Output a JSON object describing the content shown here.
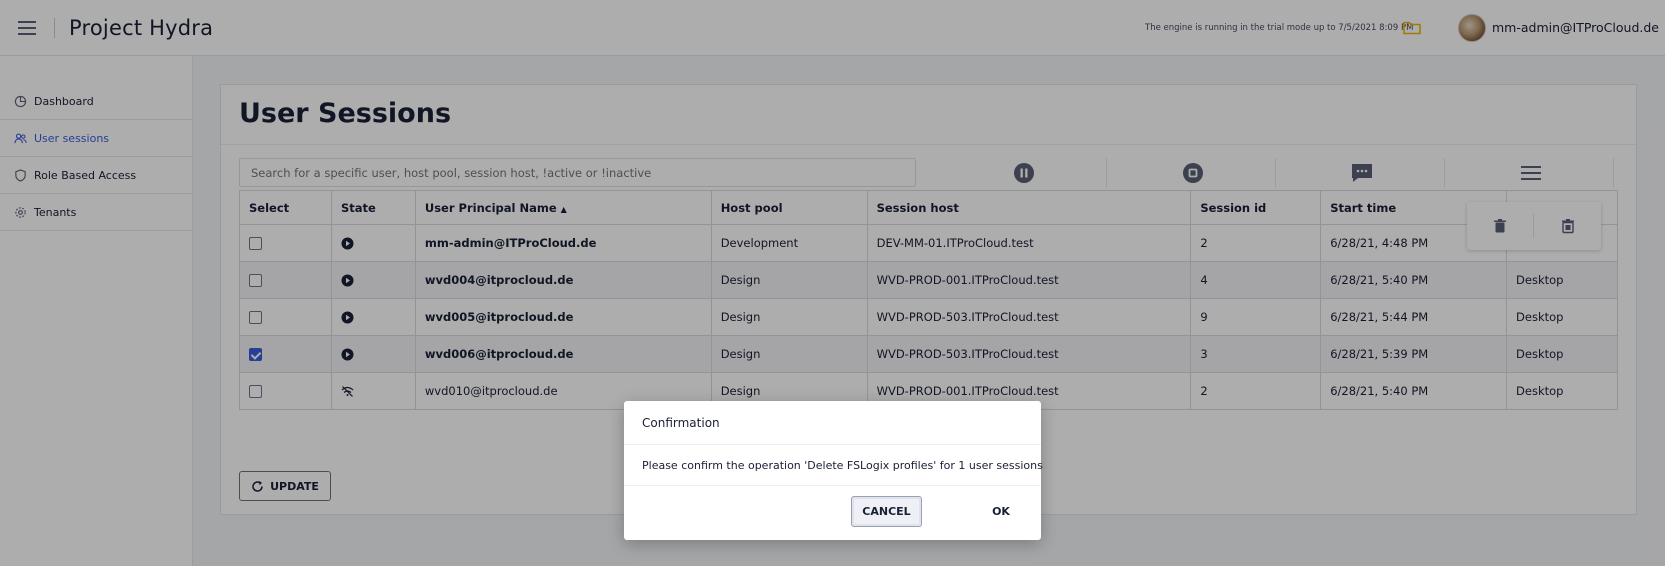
{
  "header": {
    "app_title": "Project Hydra",
    "trial_notice": "The engine is running in the trial mode up to 7/5/2021 8:09 PM",
    "user": "mm-admin@ITProCloud.de",
    "folder_color": "#f0b400"
  },
  "sidebar": {
    "items": [
      {
        "label": "Dashboard",
        "icon": "pie-chart-icon"
      },
      {
        "label": "User sessions",
        "icon": "users-icon",
        "active": true
      },
      {
        "label": "Role Based Access",
        "icon": "shield-icon"
      },
      {
        "label": "Tenants",
        "icon": "gear-icon"
      }
    ]
  },
  "main": {
    "title": "User Sessions",
    "search_placeholder": "Search for a specific user, host pool, session host, !active or !inactive",
    "toolbar_icons": [
      "pause-icon",
      "stop-icon",
      "message-icon",
      "menu-icon"
    ],
    "columns": [
      "Select",
      "State",
      "User Principal Name",
      "Host pool",
      "Session host",
      "Session id",
      "Start time",
      ""
    ],
    "sort_indicator": "▲",
    "rows": [
      {
        "checked": false,
        "state": "active",
        "upn": "mm-admin@ITProCloud.de",
        "host_pool": "Development",
        "session_host": "DEV-MM-01.ITProCloud.test",
        "session_id": "2",
        "start_time": "6/28/21, 4:48 PM",
        "type": ""
      },
      {
        "checked": false,
        "state": "active",
        "upn": "wvd004@itprocloud.de",
        "host_pool": "Design",
        "session_host": "WVD-PROD-001.ITProCloud.test",
        "session_id": "4",
        "start_time": "6/28/21, 5:40 PM",
        "type": "Desktop"
      },
      {
        "checked": false,
        "state": "active",
        "upn": "wvd005@itprocloud.de",
        "host_pool": "Design",
        "session_host": "WVD-PROD-503.ITProCloud.test",
        "session_id": "9",
        "start_time": "6/28/21, 5:44 PM",
        "type": "Desktop"
      },
      {
        "checked": true,
        "state": "active",
        "upn": "wvd006@itprocloud.de",
        "host_pool": "Design",
        "session_host": "WVD-PROD-503.ITProCloud.test",
        "session_id": "3",
        "start_time": "6/28/21, 5:39 PM",
        "type": "Desktop"
      },
      {
        "checked": false,
        "state": "disconnected",
        "upn": "wvd010@itprocloud.de",
        "host_pool": "Design",
        "session_host": "WVD-PROD-001.ITProCloud.test",
        "session_id": "2",
        "start_time": "6/28/21, 5:40 PM",
        "type": "Desktop"
      }
    ],
    "update_label": "UPDATE",
    "accent_color": "#3b5bdb"
  },
  "dialog": {
    "title": "Confirmation",
    "message": "Please confirm the operation 'Delete FSLogix profiles' for 1 user sessions",
    "cancel_label": "CANCEL",
    "ok_label": "OK"
  }
}
